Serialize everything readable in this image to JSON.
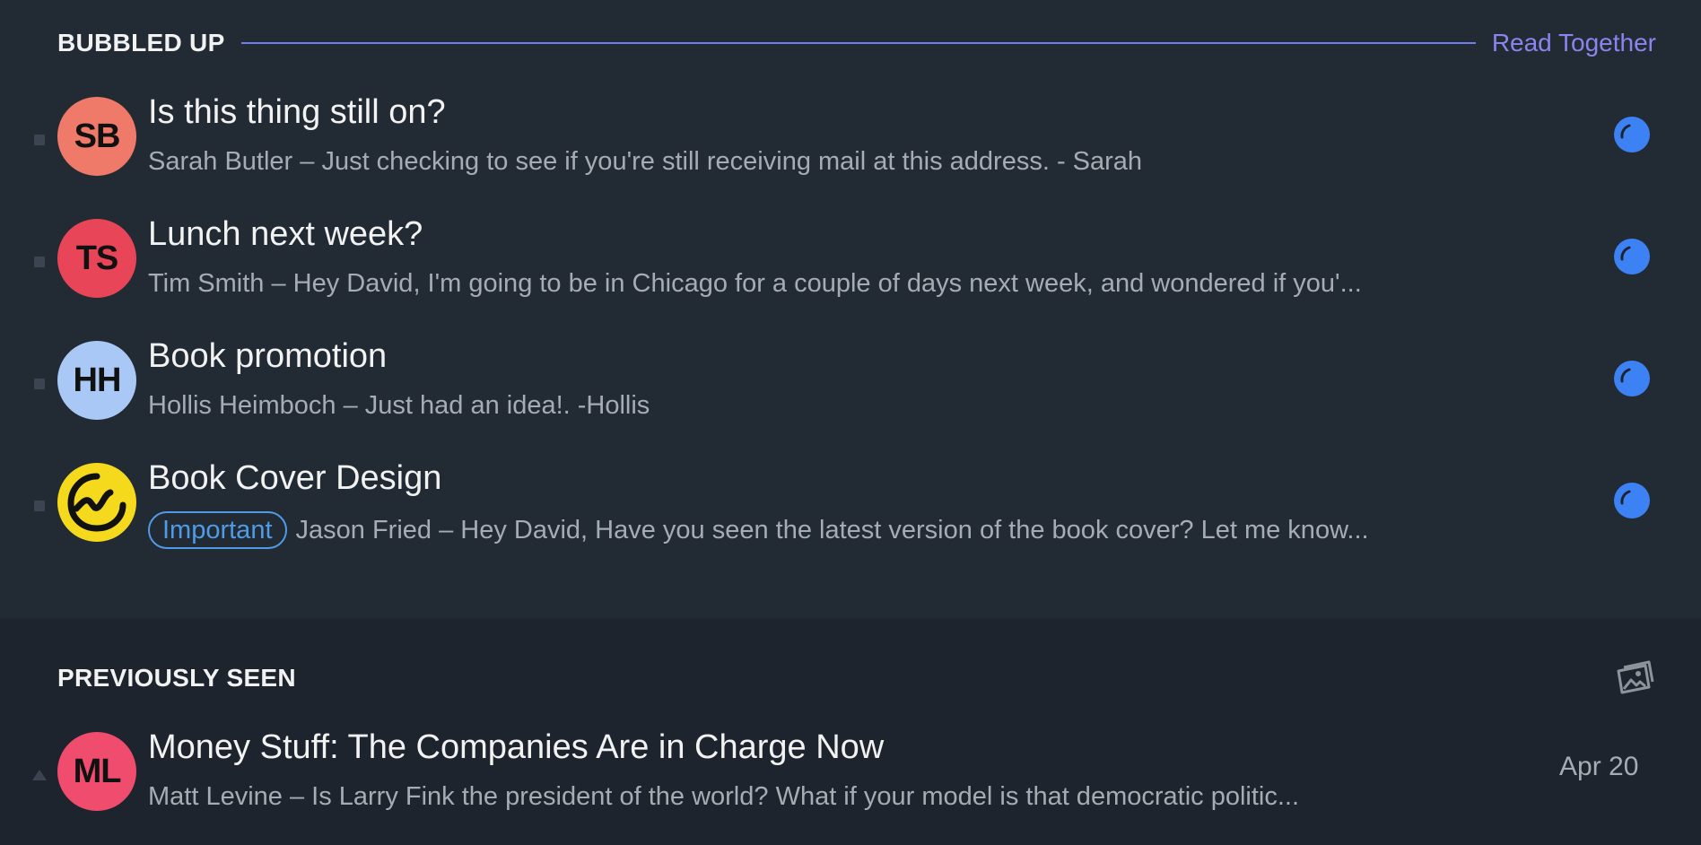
{
  "sections": {
    "bubbled_up": {
      "title": "BUBBLED UP",
      "action_label": "Read Together"
    },
    "previously_seen": {
      "title": "PREVIOUSLY SEEN",
      "action_icon": "gallery-icon"
    }
  },
  "bubbled_items": [
    {
      "initials": "SB",
      "avatar_color": "#f07a6a",
      "subject": "Is this thing still on?",
      "preview": "Sarah Butler – Just checking to see if you're still receiving mail at this address. - Sarah"
    },
    {
      "initials": "TS",
      "avatar_color": "#e84658",
      "subject": "Lunch next week?",
      "preview": "Tim Smith – Hey David, I'm going to be in Chicago for a couple of days next week, and wondered if you'..."
    },
    {
      "initials": "HH",
      "avatar_color": "#a9c8f5",
      "subject": "Book promotion",
      "preview": "Hollis Heimboch – Just had an idea!. -Hollis"
    },
    {
      "initials": "",
      "avatar_color": "#f5d91c",
      "avatar_icon": "basecamp-logo-icon",
      "subject": "Book Cover Design",
      "tag": "Important",
      "preview": "Jason Fried – Hey David, Have you seen the latest version of the book cover? Let me know..."
    }
  ],
  "seen_items": [
    {
      "initials": "ML",
      "avatar_color": "#ef4c6e",
      "subject": "Money Stuff: The Companies Are in Charge Now",
      "preview": "Matt Levine – Is Larry Fink the president of the world? What if your model is that democratic politic...",
      "date": "Apr 20"
    }
  ],
  "colors": {
    "accent_rule": "#6f7de8",
    "read_together": "#8b84ec",
    "status_dot": "#3d82f4",
    "important_tag": "#4f9be6"
  }
}
